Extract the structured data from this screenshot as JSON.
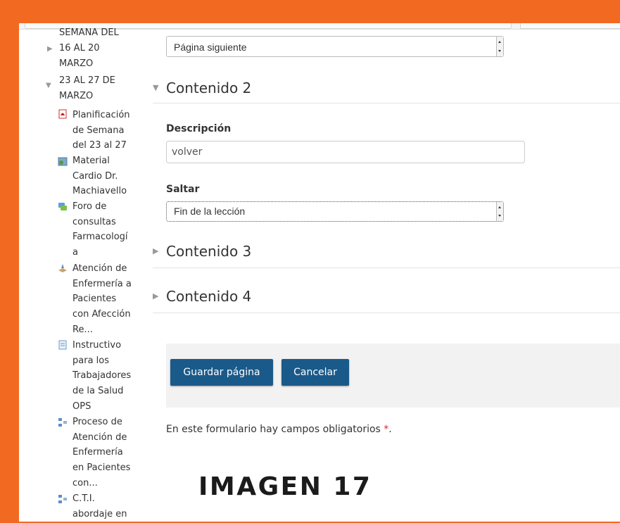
{
  "sidebar": {
    "sections": [
      {
        "lines": [
          "SEMANA DEL",
          "16 AL 20",
          "MARZO"
        ],
        "expanded": false
      },
      {
        "lines": [
          "23 AL 27 DE",
          "MARZO"
        ],
        "expanded": true
      }
    ],
    "activities": [
      {
        "icon": "pdf-icon",
        "lines": [
          "Planificación",
          "de Semana",
          "del 23 al 27"
        ]
      },
      {
        "icon": "file-icon",
        "lines": [
          "Material",
          "Cardio Dr.",
          "Machiavello"
        ]
      },
      {
        "icon": "forum-icon",
        "lines": [
          "Foro de",
          "consultas",
          "Farmacologí",
          "a"
        ]
      },
      {
        "icon": "lesson-icon",
        "lines": [
          "Atención de",
          "Enfermería a",
          "Pacientes",
          "con Afección",
          "Re..."
        ]
      },
      {
        "icon": "page-icon",
        "lines": [
          "Instructivo",
          "para los",
          "Trabajadores",
          "de la Salud",
          "OPS"
        ]
      },
      {
        "icon": "structure-icon",
        "lines": [
          "Proceso de",
          "Atención de",
          "Enfermería",
          "en Pacientes",
          "con..."
        ]
      },
      {
        "icon": "structure-icon",
        "lines": [
          "C.T.I.",
          "abordaje en"
        ]
      }
    ]
  },
  "main": {
    "top_select": "Página siguiente",
    "contenido2": {
      "title": "Contenido 2",
      "descripcion_label": "Descripción",
      "descripcion_value": "volver",
      "saltar_label": "Saltar",
      "saltar_value": "Fin de la lección"
    },
    "contenido3_title": "Contenido 3",
    "contenido4_title": "Contenido 4",
    "buttons": {
      "save": "Guardar página",
      "cancel": "Cancelar"
    },
    "required_note": "En este formulario hay campos obligatorios",
    "required_star": "*",
    "required_period": "."
  },
  "overlay": {
    "caption": "IMAGEN 17"
  },
  "colors": {
    "frame": "#f26a22",
    "button": "#1a5a8a",
    "required": "#d9262a"
  }
}
